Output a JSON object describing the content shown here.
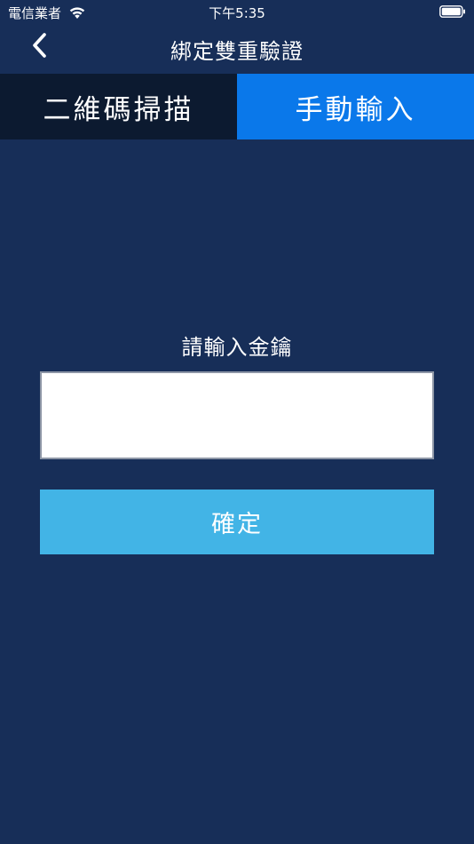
{
  "status_bar": {
    "carrier": "電信業者",
    "time": "下午5:35",
    "wifi_icon": "wifi-icon",
    "battery_icon": "battery-icon"
  },
  "nav": {
    "back_icon": "chevron-left-icon",
    "title": "綁定雙重驗證"
  },
  "tabs": [
    {
      "label": "二維碼掃描",
      "selected": false
    },
    {
      "label": "手動輸入",
      "selected": true
    }
  ],
  "form": {
    "prompt": "請輸入金鑰",
    "key_value": "",
    "confirm_label": "確定"
  },
  "colors": {
    "background": "#172e58",
    "tab_inactive": "#0c1a30",
    "tab_active": "#0a78ea",
    "confirm_button": "#42b4e6"
  }
}
